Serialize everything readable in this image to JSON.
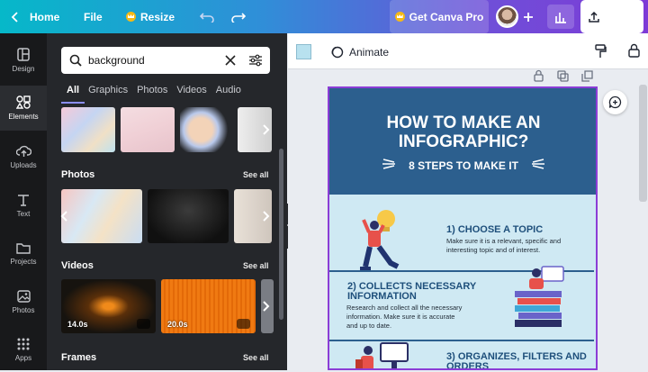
{
  "topbar": {
    "home": "Home",
    "file": "File",
    "resize": "Resize",
    "get_pro": "Get Canva Pro",
    "share": "Share"
  },
  "rail": [
    {
      "label": "Design",
      "icon": "layout-icon"
    },
    {
      "label": "Elements",
      "icon": "shapes-icon"
    },
    {
      "label": "Uploads",
      "icon": "upload-cloud-icon"
    },
    {
      "label": "Text",
      "icon": "text-t-icon"
    },
    {
      "label": "Projects",
      "icon": "folder-icon"
    },
    {
      "label": "Photos",
      "icon": "image-icon"
    },
    {
      "label": "Apps",
      "icon": "apps-grid-icon"
    }
  ],
  "panel": {
    "search": "background",
    "tabs": [
      "All",
      "Graphics",
      "Photos",
      "Videos",
      "Audio"
    ],
    "photos_title": "Photos",
    "videos_title": "Videos",
    "frames_title": "Frames",
    "see_all": "See all",
    "durations": [
      "14.0s",
      "20.0s"
    ]
  },
  "editor": {
    "animate": "Animate"
  },
  "infographic": {
    "title1": "HOW TO MAKE AN",
    "title2": "INFOGRAPHIC?",
    "subtitle": "8 STEPS TO MAKE IT",
    "step1_title": "1) CHOOSE A TOPIC",
    "step1_line1": "Make sure it is a relevant, specific and",
    "step1_line2": "interesting topic and of interest.",
    "step2_title_a": "2) COLLECTS NECESSARY",
    "step2_title_b": "INFORMATION",
    "step2_line1": "Research and collect all the necessary",
    "step2_line2": "information. Make sure it is accurate",
    "step2_line3": "and up to date.",
    "step3_title_a": "3) ORGANIZES, FILTERS AND",
    "step3_title_b": "ORDERS"
  },
  "colors": {
    "brand_teal": "#06b8c9",
    "brand_purple": "#7d3ad6",
    "hero_blue": "#2c5f8e",
    "page_bg": "#cfe9f3"
  }
}
